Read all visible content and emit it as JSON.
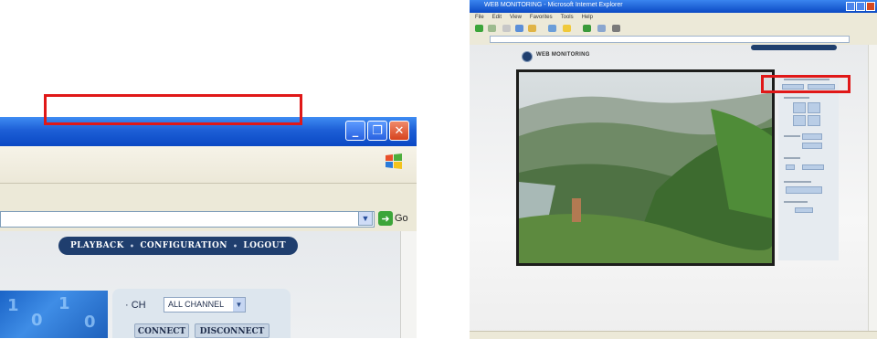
{
  "zoom": {
    "window_buttons": [
      "_",
      "❐",
      "✕"
    ],
    "go_label": "Go",
    "nav": [
      "PLAYBACK",
      "CONFIGURATION",
      "LOGOUT"
    ],
    "nav_sep": "•",
    "ch_label": "· CH",
    "ch_value": "ALL CHANNEL",
    "connect_label": "CONNECT",
    "disconnect_label": "DISCONNECT",
    "video_digits": [
      "1",
      "0",
      "1",
      "0"
    ]
  },
  "browser": {
    "title": "WEB MONITORING - Microsoft Internet Explorer",
    "menu": [
      "File",
      "Edit",
      "View",
      "Favorites",
      "Tools",
      "Help"
    ],
    "logo_text": "WEB MONITORING"
  },
  "colors": {
    "highlight": "#e01818",
    "nav_bg": "#1f3e6e"
  }
}
